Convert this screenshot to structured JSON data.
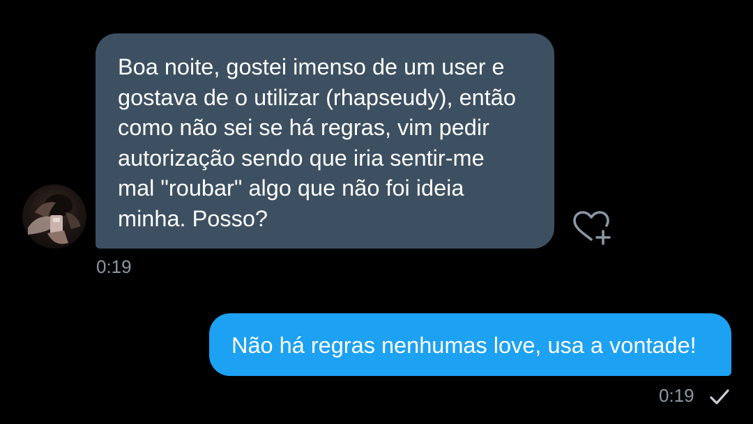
{
  "conversation": {
    "incoming": {
      "text": "Boa noite, gostei imenso de um user e\ngostava de o utilizar (rhapseudy), então\ncomo não sei se há regras, vim pedir\nautorização sendo que iria sentir-me\nmal \"roubar\" algo que não foi ideia\nminha. Posso?",
      "time": "0:19",
      "avatar_icon": "user-photo-avatar",
      "like_icon": "heart-plus-icon",
      "bubble_color": "#3d5061"
    },
    "outgoing": {
      "text": "Não há regras nenhumas love, usa a vontade!",
      "time": "0:19",
      "status_icon": "checkmark-icon",
      "bubble_color": "#1da1f2"
    },
    "colors": {
      "background": "#000000",
      "timestamp": "#8b98a5"
    }
  }
}
